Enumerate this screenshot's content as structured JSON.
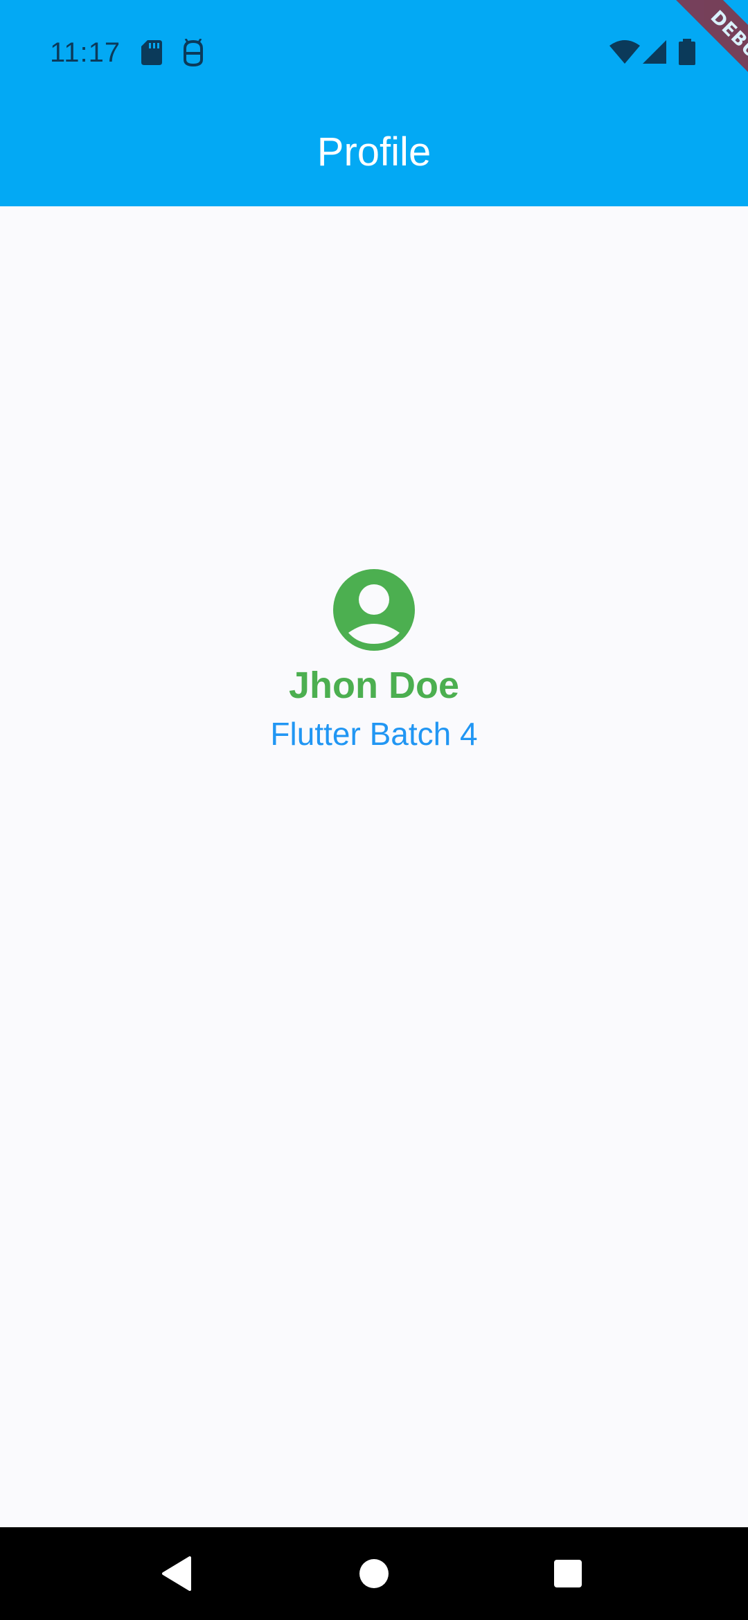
{
  "status_bar": {
    "time": "11:17",
    "icons": [
      "sd-card-icon",
      "android-debug-icon",
      "wifi-icon",
      "signal-icon",
      "battery-icon"
    ]
  },
  "app_bar": {
    "title": "Profile",
    "background_color": "#03A9F4"
  },
  "debug_banner": {
    "label": "DEBUG"
  },
  "profile": {
    "icon": "account-circle-icon",
    "icon_color": "#4CAF50",
    "name": "Jhon Doe",
    "name_color": "#4CAF50",
    "subtitle": "Flutter Batch 4",
    "subtitle_color": "#2196F3"
  },
  "nav_bar": {
    "buttons": [
      "back-icon",
      "home-icon",
      "recents-icon"
    ]
  }
}
